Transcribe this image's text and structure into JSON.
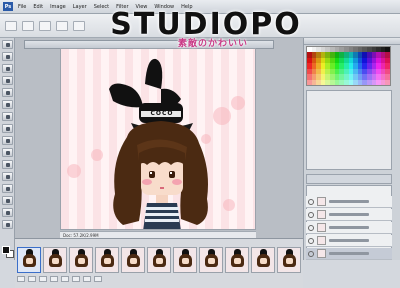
{
  "overlay": {
    "title": "STUDIOPO",
    "subtitle": "素敵のかわいい"
  },
  "menubar": {
    "app_logo": "Ps",
    "items": [
      "File",
      "Edit",
      "Image",
      "Layer",
      "Select",
      "Filter",
      "View",
      "Window",
      "Help"
    ]
  },
  "artwork": {
    "hat_text": "COCO",
    "hair_color": "#4b2a12",
    "ears_color": "#111111",
    "background_stripe": "#fbe3e6"
  },
  "document": {
    "status": "Doc: 57.2K/2.99M"
  },
  "colors": {
    "accent": "#3b6fc9",
    "subtitle": "#c93a86"
  },
  "animation": {
    "frame_count": 11
  }
}
